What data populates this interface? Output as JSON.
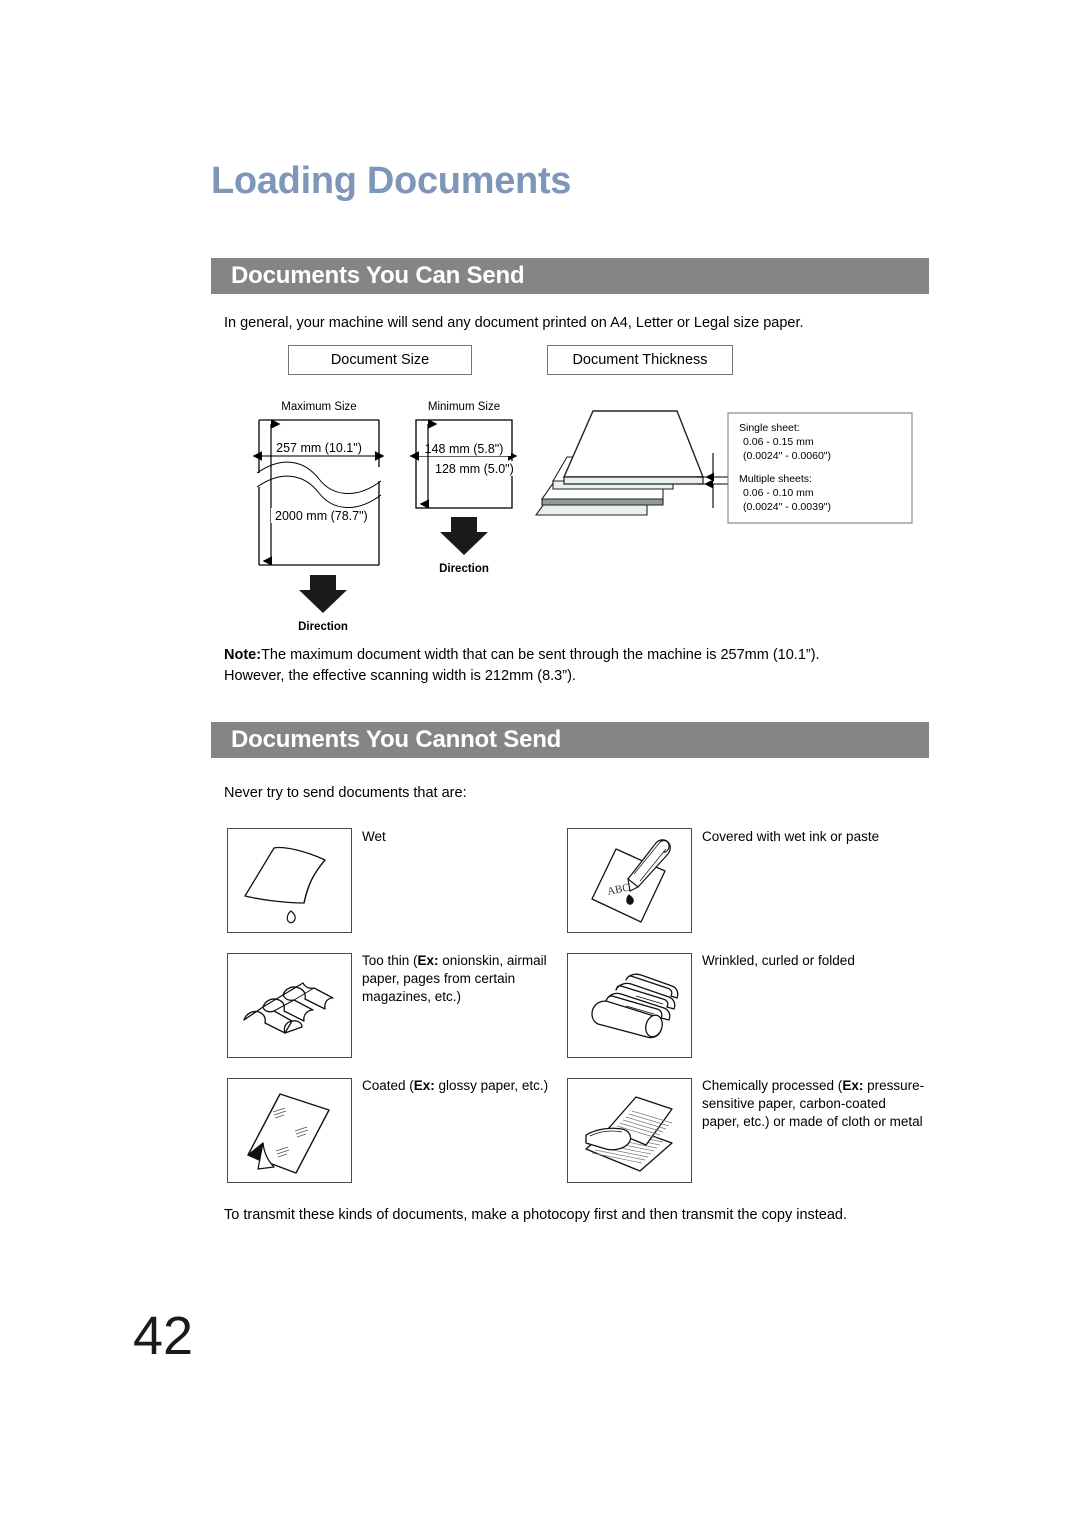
{
  "page": {
    "title": "Loading Documents",
    "number": "42"
  },
  "sections": [
    {
      "id": "can-send",
      "heading": "Documents You Can Send",
      "intro": "In general, your machine will send any document printed on A4, Letter or Legal size paper.",
      "note_label": "Note:",
      "note_text": "The maximum document width that can be sent through the machine is 257mm (10.1”).",
      "note_text_line2": "However, the effective scanning width is 212mm (8.3”)."
    },
    {
      "id": "cannot-send",
      "heading": "Documents You Cannot Send",
      "intro": "Never try to send documents that are:",
      "closing": "To transmit these kinds of documents, make a photocopy first and then transmit the copy instead."
    }
  ],
  "diagram": {
    "caption_document_size": "Document Size",
    "caption_document_thickness": "Document Thickness",
    "maximum_size_label": "Maximum Size",
    "minimum_size_label": "Minimum Size",
    "maximum_width": "257 mm (10.1\")",
    "maximum_length": "2000 mm (78.7\")",
    "minimum_width": "148 mm (5.8\")",
    "minimum_height": "128 mm (5.0\")",
    "direction_label_left": "Direction",
    "direction_label_right": "Direction",
    "thickness": {
      "single_sheet_label": "Single sheet:",
      "single_sheet_mm": "0.06 - 0.15 mm",
      "single_sheet_in": "(0.0024\" - 0.0060\")",
      "multiple_sheets_label": "Multiple sheets:",
      "multiple_sheets_mm": "0.06 - 0.10 mm",
      "multiple_sheets_in": "(0.0024\" - 0.0039\")"
    }
  },
  "cannot_send_items": [
    {
      "icon": "wet-paper-icon",
      "label": "Wet",
      "label_pre": "Wet",
      "label_ex": "",
      "label_post": ""
    },
    {
      "icon": "pen-ink-paper-icon",
      "label": "Covered with wet ink or paste",
      "label_pre": "Covered with wet ink or paste",
      "label_ex": "",
      "label_post": ""
    },
    {
      "icon": "thin-wavy-paper-icon",
      "label": "Too thin (Ex: onionskin, airmail paper, pages from certain magazines, etc.)",
      "label_pre": "Too thin (",
      "label_ex": "Ex:",
      "label_post": " onionskin, airmail paper, pages from certain magazines, etc.)"
    },
    {
      "icon": "wrinkled-curled-paper-icon",
      "label": "Wrinkled, curled or folded",
      "label_pre": "Wrinkled, curled or folded",
      "label_ex": "",
      "label_post": ""
    },
    {
      "icon": "glossy-coated-paper-icon",
      "label": "Coated (Ex: glossy paper, etc.)",
      "label_pre": "Coated (",
      "label_ex": "Ex:",
      "label_post": " glossy paper, etc.)"
    },
    {
      "icon": "carbon-paper-icon",
      "label": "Chemically processed (Ex: pressure-sensitive paper, carbon-coated paper, etc.) or made of cloth or metal",
      "label_pre": "Chemically processed (",
      "label_ex": "Ex:",
      "label_post": " pressure-sensitive paper, carbon-coated paper, etc.) or made of cloth or metal"
    }
  ],
  "colors": {
    "title": "#7e96b8",
    "section_bar": "#858585",
    "section_bar_text": "#ffffff",
    "caption_border": "#7a7080",
    "sheet_tint": "#e8f0f0",
    "line": "#000000"
  }
}
